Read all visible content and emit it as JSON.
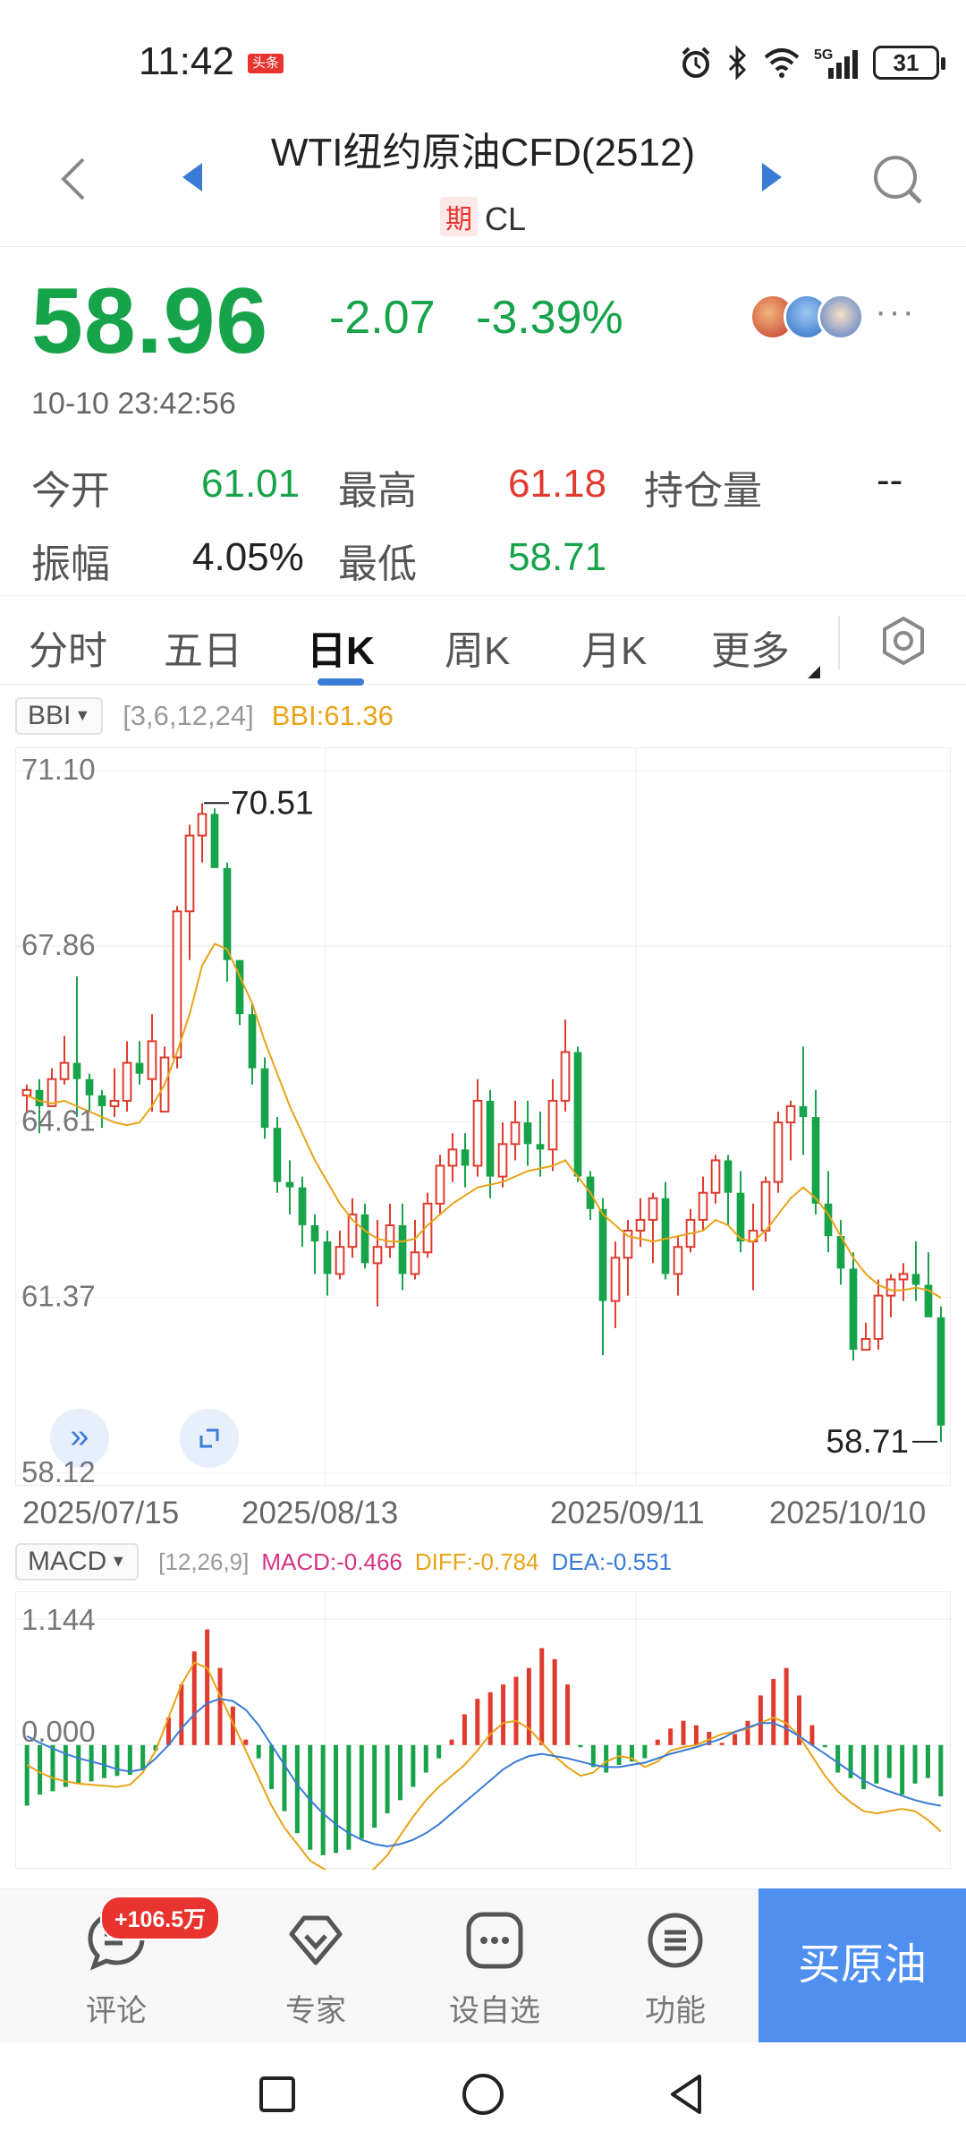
{
  "status_bar": {
    "time": "11:42",
    "app_badge": "头条",
    "network": "5G",
    "battery": "31"
  },
  "header": {
    "title": "WTI纽约原油CFD(2512)",
    "tag": "期",
    "symbol": "CL"
  },
  "quote": {
    "price": "58.96",
    "change": "-2.07",
    "change_pct": "-3.39%",
    "timestamp": "10-10 23:42:56",
    "more": "···"
  },
  "stats": {
    "open_label": "今开",
    "open_value": "61.01",
    "high_label": "最高",
    "high_value": "61.18",
    "oi_label": "持仓量",
    "oi_value": "--",
    "amp_label": "振幅",
    "amp_value": "4.05%",
    "low_label": "最低",
    "low_value": "58.71"
  },
  "tabs": [
    {
      "label": "分时"
    },
    {
      "label": "五日"
    },
    {
      "label": "日K"
    },
    {
      "label": "周K"
    },
    {
      "label": "月K"
    },
    {
      "label": "更多"
    }
  ],
  "bbi": {
    "selector": "BBI",
    "params": "[3,6,12,24]",
    "value": "BBI:61.36"
  },
  "macd": {
    "selector": "MACD",
    "params": "[12,26,9]",
    "macd_value": "MACD:-0.466",
    "diff_value": "DIFF:-0.784",
    "dea_value": "DEA:-0.551"
  },
  "colors": {
    "up": "#e03b2f",
    "down": "#17a34a",
    "bbi_line": "#e8a317",
    "diff_line": "#e8a317",
    "dea_line": "#3a7bd5",
    "macd_text": "#d63384",
    "accent": "#4e8ff0"
  },
  "chart_data": [
    {
      "type": "candlestick",
      "y_ticks": [
        "71.10",
        "67.86",
        "64.61",
        "61.37",
        "58.12"
      ],
      "ylim": [
        58.12,
        71.1
      ],
      "x_labels": [
        "2025/07/15",
        "2025/08/13",
        "2025/09/11",
        "2025/10/10"
      ],
      "max_label": "70.51",
      "min_label": "58.71",
      "series": [
        {
          "name": "BBI",
          "candles": [
            [
              65.1,
              65.3,
              64.8,
              65.2
            ],
            [
              65.2,
              65.4,
              64.4,
              64.9
            ],
            [
              64.9,
              65.6,
              64.9,
              65.4
            ],
            [
              65.4,
              66.2,
              65.3,
              65.7
            ],
            [
              65.7,
              67.3,
              64.7,
              65.4
            ],
            [
              65.4,
              65.5,
              64.8,
              65.1
            ],
            [
              65.1,
              65.2,
              64.5,
              64.9
            ],
            [
              64.9,
              65.6,
              64.7,
              65.0
            ],
            [
              65.0,
              66.1,
              64.8,
              65.7
            ],
            [
              65.7,
              66.1,
              65.3,
              65.5
            ],
            [
              65.4,
              66.6,
              64.8,
              66.1
            ],
            [
              64.8,
              66.0,
              64.8,
              65.8
            ],
            [
              65.8,
              68.6,
              65.6,
              68.5
            ],
            [
              68.5,
              70.1,
              67.6,
              69.9
            ],
            [
              69.9,
              70.5,
              69.4,
              70.3
            ],
            [
              70.3,
              70.4,
              69.4,
              69.3
            ],
            [
              69.3,
              69.4,
              67.2,
              67.6
            ],
            [
              67.6,
              67.6,
              66.4,
              66.6
            ],
            [
              66.6,
              66.8,
              65.3,
              65.6
            ],
            [
              65.6,
              65.8,
              64.3,
              64.5
            ],
            [
              64.5,
              64.7,
              63.3,
              63.5
            ],
            [
              63.5,
              63.9,
              62.9,
              63.4
            ],
            [
              63.4,
              63.6,
              62.3,
              62.7
            ],
            [
              62.7,
              62.9,
              61.8,
              62.4
            ],
            [
              62.4,
              62.6,
              61.4,
              61.8
            ],
            [
              61.8,
              62.6,
              61.7,
              62.3
            ],
            [
              62.3,
              63.2,
              62.1,
              62.9
            ],
            [
              62.9,
              63.1,
              61.9,
              62.0
            ],
            [
              62.0,
              62.8,
              61.2,
              62.3
            ],
            [
              62.3,
              63.1,
              62.1,
              62.7
            ],
            [
              62.7,
              63.1,
              61.5,
              61.8
            ],
            [
              61.8,
              62.8,
              61.7,
              62.2
            ],
            [
              62.2,
              63.3,
              62.1,
              63.1
            ],
            [
              63.1,
              64.0,
              62.9,
              63.8
            ],
            [
              63.8,
              64.4,
              63.5,
              64.1
            ],
            [
              64.1,
              64.4,
              63.4,
              63.8
            ],
            [
              63.8,
              65.4,
              63.6,
              65.0
            ],
            [
              65.0,
              65.2,
              63.2,
              63.6
            ],
            [
              63.6,
              64.6,
              63.4,
              64.2
            ],
            [
              64.2,
              65.0,
              63.9,
              64.6
            ],
            [
              64.6,
              65.0,
              63.8,
              64.2
            ],
            [
              64.2,
              64.8,
              63.6,
              64.1
            ],
            [
              64.1,
              65.4,
              63.7,
              65.0
            ],
            [
              65.0,
              66.5,
              64.8,
              65.9
            ],
            [
              65.9,
              66.0,
              63.5,
              63.6
            ],
            [
              63.6,
              63.7,
              62.8,
              63.0
            ],
            [
              63.0,
              63.2,
              60.3,
              61.3
            ],
            [
              61.3,
              62.4,
              60.8,
              62.1
            ],
            [
              62.1,
              62.8,
              61.4,
              62.6
            ],
            [
              62.6,
              63.2,
              62.3,
              62.8
            ],
            [
              62.8,
              63.3,
              62.0,
              63.2
            ],
            [
              63.2,
              63.5,
              61.7,
              61.8
            ],
            [
              61.8,
              62.5,
              61.4,
              62.3
            ],
            [
              62.3,
              63.0,
              62.2,
              62.8
            ],
            [
              62.8,
              63.6,
              62.6,
              63.3
            ],
            [
              63.3,
              64.0,
              63.1,
              63.9
            ],
            [
              63.9,
              64.0,
              62.7,
              63.3
            ],
            [
              63.3,
              63.7,
              62.2,
              62.4
            ],
            [
              62.4,
              63.1,
              61.5,
              62.6
            ],
            [
              62.6,
              63.6,
              62.4,
              63.5
            ],
            [
              63.5,
              64.8,
              63.3,
              64.6
            ],
            [
              64.6,
              65.0,
              63.9,
              64.9
            ],
            [
              64.9,
              66.0,
              64.0,
              64.7
            ],
            [
              64.7,
              65.2,
              62.9,
              63.1
            ],
            [
              63.1,
              63.7,
              62.2,
              62.5
            ],
            [
              62.5,
              62.8,
              61.6,
              61.9
            ],
            [
              61.9,
              62.2,
              60.2,
              60.4
            ],
            [
              60.4,
              60.9,
              60.4,
              60.6
            ],
            [
              60.6,
              61.7,
              60.4,
              61.4
            ],
            [
              61.4,
              61.8,
              61.0,
              61.7
            ],
            [
              61.7,
              62.0,
              61.3,
              61.8
            ],
            [
              61.8,
              62.4,
              61.3,
              61.6
            ],
            [
              61.6,
              62.2,
              61.0,
              61.0
            ],
            [
              61.0,
              61.2,
              58.7,
              59.0
            ]
          ],
          "bbi": [
            65.1,
            65.0,
            64.95,
            65.0,
            64.9,
            64.8,
            64.7,
            64.6,
            64.55,
            64.6,
            64.9,
            65.3,
            65.9,
            66.6,
            67.5,
            67.9,
            67.8,
            67.3,
            66.8,
            66.1,
            65.5,
            64.9,
            64.4,
            63.9,
            63.5,
            63.1,
            62.8,
            62.6,
            62.45,
            62.4,
            62.4,
            62.45,
            62.7,
            62.9,
            63.1,
            63.25,
            63.4,
            63.45,
            63.5,
            63.6,
            63.7,
            63.75,
            63.8,
            63.9,
            63.6,
            63.3,
            62.9,
            62.7,
            62.5,
            62.45,
            62.4,
            62.45,
            62.5,
            62.55,
            62.6,
            62.8,
            62.7,
            62.45,
            62.4,
            62.6,
            62.9,
            63.2,
            63.4,
            63.2,
            62.9,
            62.5,
            62.1,
            61.8,
            61.6,
            61.5,
            61.5,
            61.55,
            61.5,
            61.36
          ]
        }
      ]
    },
    {
      "type": "bar+line",
      "y_ticks": [
        "1.144",
        "0.000"
      ],
      "series": [
        {
          "name": "MACD",
          "values": [
            -0.55,
            -0.45,
            -0.42,
            -0.38,
            -0.35,
            -0.33,
            -0.3,
            -0.28,
            -0.27,
            -0.22,
            -0.05,
            0.25,
            0.55,
            0.85,
            1.05,
            0.7,
            0.35,
            0.05,
            -0.12,
            -0.4,
            -0.6,
            -0.8,
            -0.95,
            -1.0,
            -0.98,
            -0.95,
            -0.85,
            -0.75,
            -0.62,
            -0.5,
            -0.38,
            -0.25,
            -0.12,
            0.05,
            0.28,
            0.42,
            0.48,
            0.55,
            0.62,
            0.7,
            0.88,
            0.78,
            0.55,
            -0.02,
            -0.2,
            -0.25,
            -0.18,
            -0.15,
            -0.12,
            0.05,
            0.15,
            0.22,
            0.18,
            0.12,
            0.02,
            0.1,
            0.22,
            0.45,
            0.6,
            0.7,
            0.45,
            0.18,
            -0.02,
            -0.25,
            -0.3,
            -0.4,
            -0.35,
            -0.3,
            -0.45,
            -0.35,
            -0.3,
            -0.466
          ]
        },
        {
          "name": "DIFF",
          "values": [
            -0.18,
            -0.25,
            -0.3,
            -0.33,
            -0.35,
            -0.36,
            -0.37,
            -0.38,
            -0.36,
            -0.25,
            -0.05,
            0.25,
            0.55,
            0.75,
            0.7,
            0.45,
            0.2,
            -0.05,
            -0.3,
            -0.55,
            -0.75,
            -0.9,
            -1.05,
            -1.12,
            -1.18,
            -1.22,
            -1.2,
            -1.12,
            -1.0,
            -0.82,
            -0.65,
            -0.5,
            -0.38,
            -0.28,
            -0.18,
            -0.05,
            0.1,
            0.2,
            0.22,
            0.15,
            0.02,
            -0.1,
            -0.2,
            -0.28,
            -0.25,
            -0.15,
            -0.1,
            -0.12,
            -0.2,
            -0.15,
            -0.05,
            -0.02,
            0.0,
            0.05,
            0.1,
            0.12,
            0.15,
            0.2,
            0.25,
            0.2,
            0.08,
            -0.1,
            -0.28,
            -0.42,
            -0.52,
            -0.6,
            -0.62,
            -0.6,
            -0.58,
            -0.6,
            -0.68,
            -0.784
          ]
        },
        {
          "name": "DEA",
          "values": [
            0.08,
            0.02,
            -0.03,
            -0.08,
            -0.12,
            -0.15,
            -0.18,
            -0.22,
            -0.24,
            -0.22,
            -0.12,
            0.0,
            0.15,
            0.28,
            0.38,
            0.42,
            0.4,
            0.32,
            0.18,
            0.0,
            -0.18,
            -0.36,
            -0.5,
            -0.62,
            -0.72,
            -0.8,
            -0.86,
            -0.9,
            -0.92,
            -0.9,
            -0.86,
            -0.8,
            -0.72,
            -0.62,
            -0.52,
            -0.42,
            -0.32,
            -0.22,
            -0.15,
            -0.1,
            -0.08,
            -0.1,
            -0.12,
            -0.15,
            -0.18,
            -0.2,
            -0.2,
            -0.18,
            -0.16,
            -0.12,
            -0.08,
            -0.05,
            -0.02,
            0.02,
            0.06,
            0.12,
            0.16,
            0.2,
            0.2,
            0.15,
            0.08,
            0.0,
            -0.08,
            -0.16,
            -0.24,
            -0.32,
            -0.38,
            -0.42,
            -0.46,
            -0.5,
            -0.53,
            -0.551
          ]
        }
      ]
    }
  ],
  "bottom_bar": {
    "comment_label": "评论",
    "comment_badge": "+106.5万",
    "expert_label": "专家",
    "watchlist_label": "设自选",
    "function_label": "功能",
    "buy_label": "买原油"
  }
}
